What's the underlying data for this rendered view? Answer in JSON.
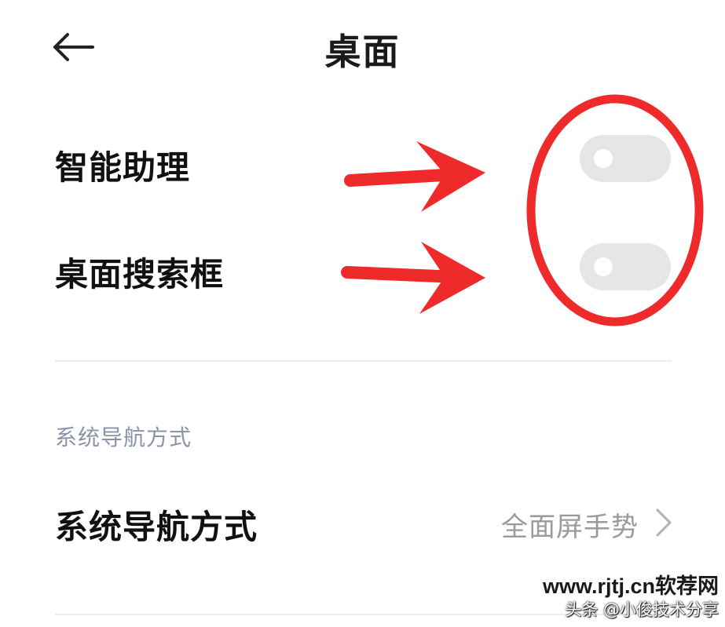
{
  "header": {
    "back_icon": "arrow-left-icon",
    "title": "桌面"
  },
  "settings": [
    {
      "label": "智能助理",
      "toggle_on": false
    },
    {
      "label": "桌面搜索框",
      "toggle_on": false
    }
  ],
  "section": {
    "header": "系统导航方式",
    "row_label": "系统导航方式",
    "row_value": "全面屏手势",
    "row_icon": "chevron-right-icon"
  },
  "annotations": {
    "color": "#ee2a2a",
    "arrow_count": 2,
    "ellipse_shape": "circle-around-toggles"
  },
  "watermark": {
    "line1": "www.rjtj.cn软荐网",
    "line2": "头条 @小俊技术分享"
  },
  "colors": {
    "background": "#ffffff",
    "toggle_off": "#e6e6e6",
    "section_header": "#8a93a8",
    "secondary_text": "#9a9a9a",
    "annotation_red": "#ee2a2a"
  }
}
